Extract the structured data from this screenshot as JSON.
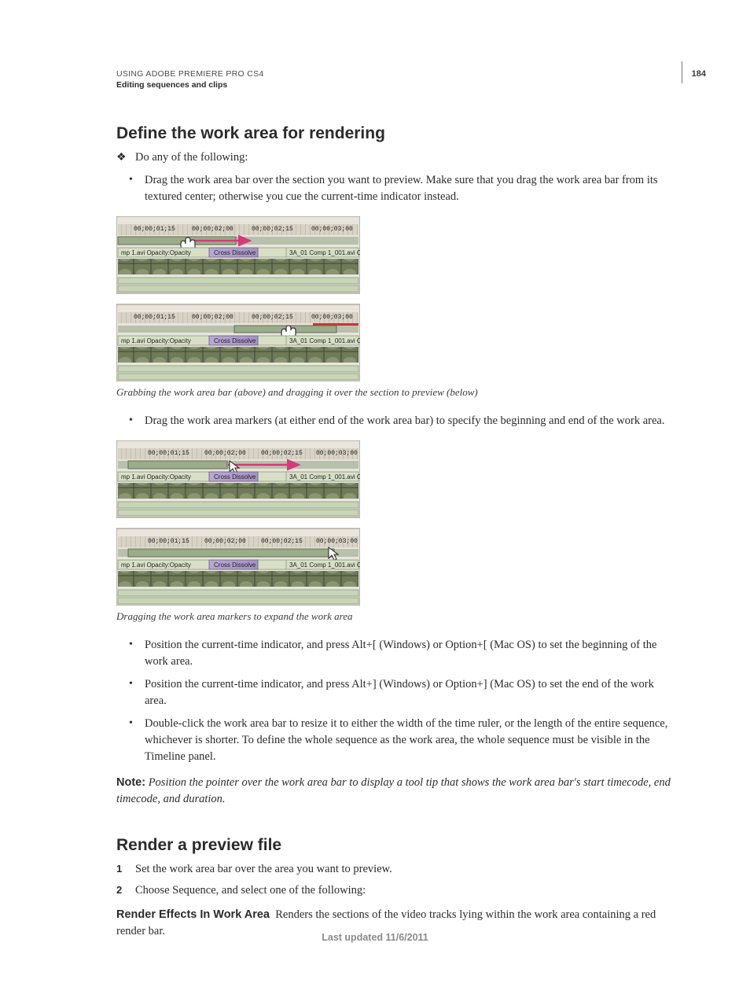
{
  "header": {
    "line1": "USING ADOBE PREMIERE PRO CS4",
    "line2": "Editing sequences and clips",
    "page_number": "184"
  },
  "section1": {
    "title": "Define the work area for rendering",
    "lead": "Do any of the following:",
    "bullet_a": "Drag the work area bar over the section you want to preview. Make sure that you drag the work area bar from its textured center; otherwise you cue the current-time indicator instead.",
    "caption1": "Grabbing the work area bar (above) and dragging it over the section to preview (below)",
    "bullet_b": "Drag the work area markers (at either end of the work area bar) to specify the beginning and end of the work area.",
    "caption2": "Dragging the work area markers to expand the work area",
    "bullet_c": "Position the current-time indicator, and press Alt+[ (Windows) or Option+[ (Mac OS) to set the beginning of the work area.",
    "bullet_d": "Position the current-time indicator, and press Alt+] (Windows) or Option+] (Mac OS) to set the end of the work area.",
    "bullet_e": "Double-click the work area bar to resize it to either the width of the time ruler, or the length of the entire sequence, whichever is shorter. To define the whole sequence as the work area, the whole sequence must be visible in the Timeline panel."
  },
  "note": {
    "label": "Note:",
    "body": "Position the pointer over the work area bar to display a tool tip that shows the work area bar's start timecode, end timecode, and duration."
  },
  "section2": {
    "title": "Render a preview file",
    "step1": "Set the work area bar over the area you want to preview.",
    "step2": "Choose Sequence, and select one of the following:",
    "def_term": "Render Effects In Work Area",
    "def_body": "Renders the sections of the video tracks lying within the work area containing a red render bar."
  },
  "footer": {
    "text": "Last updated 11/6/2011"
  },
  "timeline": {
    "timecodes": [
      "00;00;01;15",
      "00;00;02;00",
      "00;00;02;15",
      "00;00;03;00"
    ],
    "clip_left": "mp 1.avi Opacity:Opacity",
    "transition": "Cross Dissolve",
    "clip_right": "3A_01 Comp 1_001.avi Opac"
  }
}
